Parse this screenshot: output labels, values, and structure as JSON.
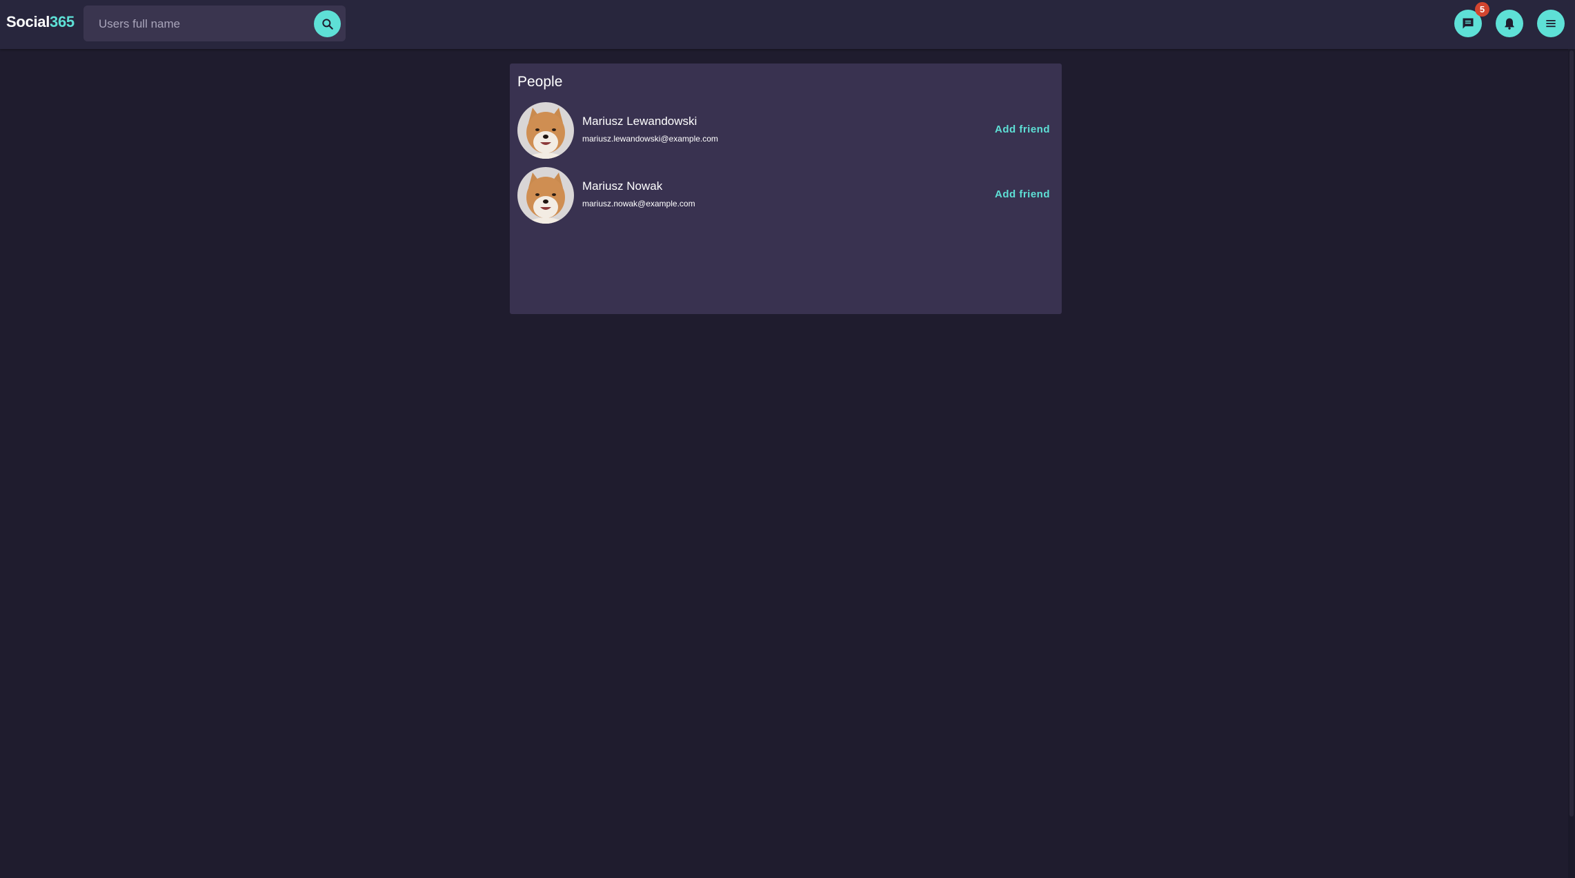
{
  "header": {
    "logo_main": "Social",
    "logo_accent": "365",
    "search_placeholder": "Users full name",
    "messages_badge": "5",
    "icons": [
      "search-icon",
      "chat-icon",
      "bell-icon",
      "menu-icon"
    ]
  },
  "people": {
    "title": "People",
    "items": [
      {
        "name": "Mariusz Lewandowski",
        "email": "mariusz.lewandowski@example.com",
        "action": "Add friend"
      },
      {
        "name": "Mariusz Nowak",
        "email": "mariusz.nowak@example.com",
        "action": "Add friend"
      }
    ]
  },
  "colors": {
    "background": "#1f1c2e",
    "topbar": "#28263d",
    "card": "#393250",
    "accent": "#5ee0d6",
    "badge": "#d2452f"
  }
}
